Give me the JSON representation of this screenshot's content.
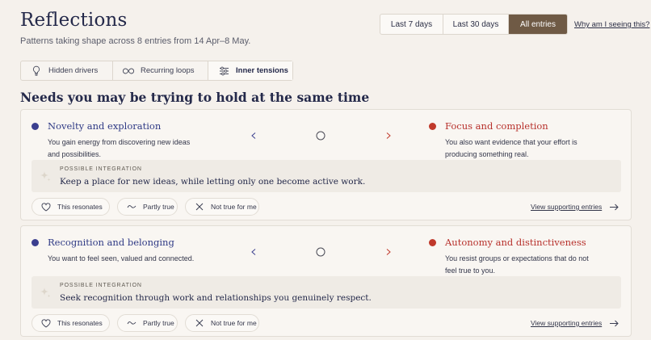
{
  "header": {
    "title": "Reflections",
    "subtitle": "Patterns taking shape across 8 entries from 14 Apr–8 May."
  },
  "range": {
    "options": [
      "Last 7 days",
      "Last 30 days",
      "All entries"
    ],
    "selected": "All entries",
    "why_link": "Why am I seeing this?"
  },
  "tabs": {
    "items": [
      {
        "label": "Hidden drivers",
        "icon": "lightbulb-icon"
      },
      {
        "label": "Recurring loops",
        "icon": "loop-icon"
      },
      {
        "label": "Inner tensions",
        "icon": "sliders-icon"
      }
    ],
    "active": "Inner tensions"
  },
  "section_title": "Needs you may be trying to hold at the same time",
  "tensions": [
    {
      "left": {
        "name": "Novelty and exploration",
        "description": "You gain energy from discovering new ideas and possibilities."
      },
      "right": {
        "name": "Focus and completion",
        "description": "You also want evidence that your effort is producing something real."
      },
      "integration_label": "POSSIBLE INTEGRATION",
      "integration_text": "Keep a place for new ideas, while letting only one become active work.",
      "actions": [
        "This resonates",
        "Partly true",
        "Not true for me"
      ],
      "view_link": "View supporting entries"
    },
    {
      "left": {
        "name": "Recognition and belonging",
        "description": "You want to feel seen, valued and connected."
      },
      "right": {
        "name": "Autonomy and distinctiveness",
        "description": "You resist groups or expectations that do not feel true to you."
      },
      "integration_label": "POSSIBLE INTEGRATION",
      "integration_text": "Seek recognition through work and relationships you genuinely respect.",
      "actions": [
        "This resonates",
        "Partly true",
        "Not true for me"
      ],
      "view_link": "View supporting entries"
    }
  ],
  "colors": {
    "left_need": "#3b3f8f",
    "right_need": "#c0392b",
    "selected_range_bg": "#6f5a45",
    "page_bg": "#f5f1ec"
  }
}
